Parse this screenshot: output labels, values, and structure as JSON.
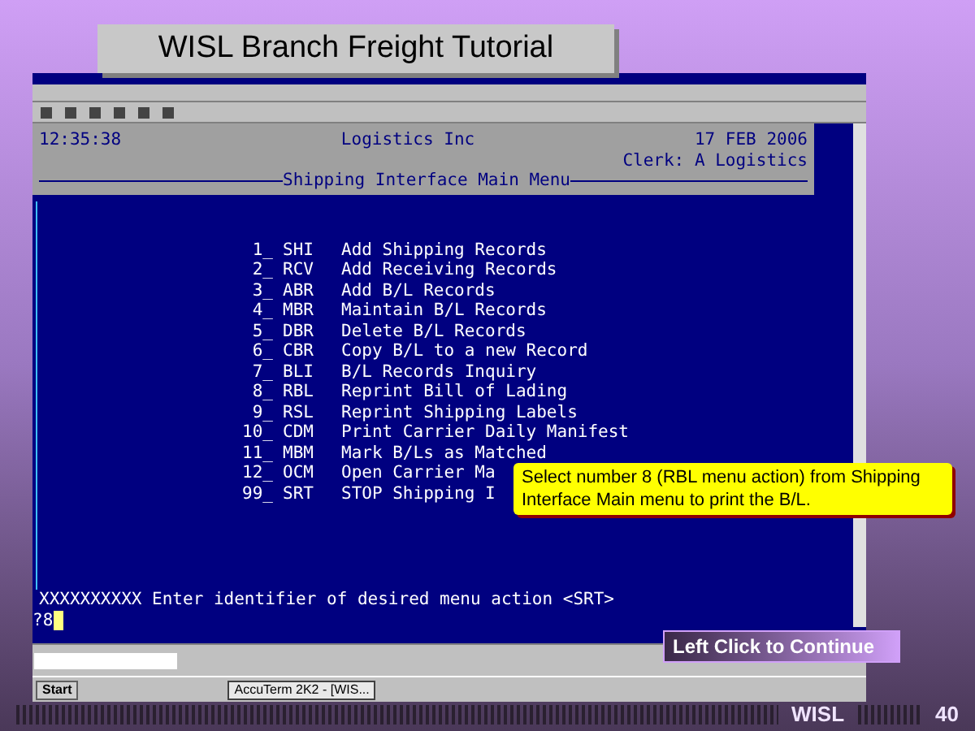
{
  "slide_title": "WISL Branch Freight Tutorial",
  "terminal": {
    "time": "12:35:38",
    "company": "Logistics Inc",
    "date": "17 FEB 2006",
    "clerk": "Clerk: A Logistics",
    "menu_title": "Shipping Interface Main Menu",
    "menu_items": [
      {
        "number": "1_",
        "code": "SHI",
        "label": "Add Shipping Records"
      },
      {
        "number": "2_",
        "code": "RCV",
        "label": "Add Receiving Records"
      },
      {
        "number": "3_",
        "code": "ABR",
        "label": "Add B/L Records"
      },
      {
        "number": "4_",
        "code": "MBR",
        "label": "Maintain B/L Records"
      },
      {
        "number": "5_",
        "code": "DBR",
        "label": "Delete B/L Records"
      },
      {
        "number": "6_",
        "code": "CBR",
        "label": "Copy B/L to a new Record"
      },
      {
        "number": "7_",
        "code": "BLI",
        "label": "B/L Records Inquiry"
      },
      {
        "number": "8_",
        "code": "RBL",
        "label": "Reprint Bill of Lading"
      },
      {
        "number": "9_",
        "code": "RSL",
        "label": "Reprint Shipping Labels"
      },
      {
        "number": "10_",
        "code": "CDM",
        "label": "Print Carrier Daily Manifest"
      },
      {
        "number": "11_",
        "code": "MBM",
        "label": "Mark B/Ls as Matched"
      },
      {
        "number": "12_",
        "code": "OCM",
        "label": "Open Carrier Ma"
      },
      {
        "number": "99_",
        "code": "SRT",
        "label": "STOP Shipping I"
      }
    ],
    "prompt": "XXXXXXXXXX Enter identifier of desired menu action <SRT>",
    "input": "?8"
  },
  "taskbar": {
    "start": "Start",
    "tasks": [
      {
        "label": "AccuTerm 2K2 - [WIS...",
        "selected": true
      }
    ]
  },
  "callout": "Select number 8 (RBL menu action) from Shipping Interface Main menu to print the B/L.",
  "continue_button": "Left Click to Continue",
  "footer": {
    "brand": "WISL",
    "page": "40"
  }
}
